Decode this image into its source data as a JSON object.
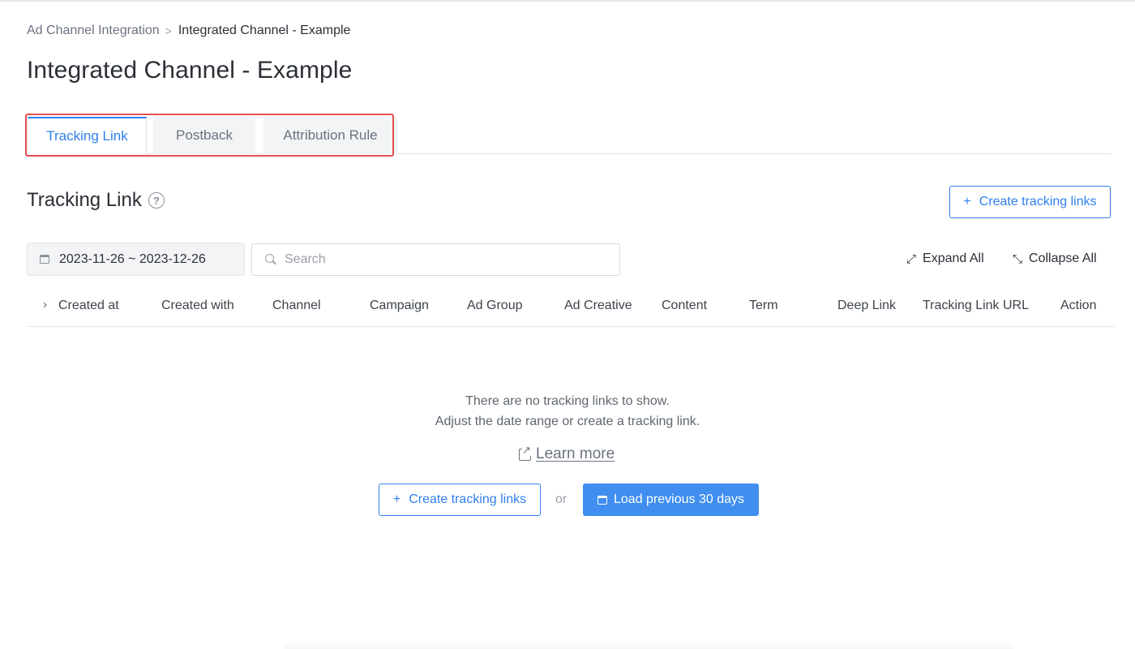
{
  "breadcrumb": {
    "parent": "Ad Channel Integration",
    "separator": ">",
    "current": "Integrated Channel - Example"
  },
  "page": {
    "title": "Integrated Channel - Example"
  },
  "tabs": [
    {
      "label": "Tracking Link",
      "active": true
    },
    {
      "label": "Postback",
      "active": false
    },
    {
      "label": "Attribution Rule",
      "active": false
    }
  ],
  "section": {
    "title": "Tracking Link",
    "help_icon": "?",
    "create_button": "Create tracking links"
  },
  "filters": {
    "date_range": "2023-11-26 ~ 2023-12-26",
    "search_placeholder": "Search",
    "expand_all": "Expand All",
    "collapse_all": "Collapse All"
  },
  "table": {
    "columns": [
      "Created at",
      "Created with",
      "Channel",
      "Campaign",
      "Ad Group",
      "Ad Creative",
      "Content",
      "Term",
      "Deep Link",
      "Tracking Link URL",
      "Action"
    ]
  },
  "empty_state": {
    "line1": "There are no tracking links to show.",
    "line2": "Adjust the date range or create a tracking link.",
    "learn_more": "Learn more",
    "create_button": "Create tracking links",
    "or": "or",
    "load_button": "Load previous 30 days"
  },
  "colors": {
    "accent": "#2f80ed",
    "primary_button": "#3f8ef0",
    "highlight_box": "#e55050"
  }
}
